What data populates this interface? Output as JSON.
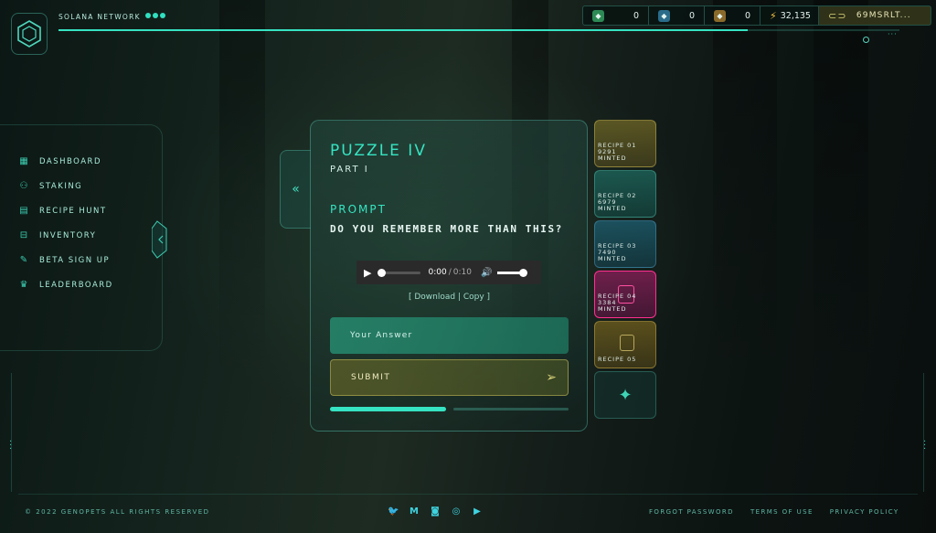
{
  "header": {
    "network_label": "SOLANA NETWORK",
    "stats": [
      {
        "icon": "gene-green-icon",
        "value": "0"
      },
      {
        "icon": "gene-blue-icon",
        "value": "0"
      },
      {
        "icon": "gene-orange-icon",
        "value": "0"
      },
      {
        "icon": "energy-bolt-icon",
        "value": "32,135"
      }
    ],
    "wallet": "69MSRLT...",
    "top_progress": 0.82
  },
  "sidebar": {
    "items": [
      {
        "label": "DASHBOARD",
        "icon": "dashboard-icon"
      },
      {
        "label": "STAKING",
        "icon": "staking-icon"
      },
      {
        "label": "RECIPE HUNT",
        "icon": "recipe-hunt-icon"
      },
      {
        "label": "INVENTORY",
        "icon": "inventory-icon"
      },
      {
        "label": "BETA SIGN UP",
        "icon": "beta-signup-icon"
      },
      {
        "label": "LEADERBOARD",
        "icon": "leaderboard-icon"
      }
    ]
  },
  "puzzle": {
    "title": "PUZZLE IV",
    "part": "PART I",
    "prompt_heading": "PROMPT",
    "prompt_text": "DO YOU REMEMBER MORE THAN THIS?",
    "audio": {
      "current": "0:00",
      "separator": "/",
      "duration": "0:10"
    },
    "download_label": "[ Download | Copy ]",
    "answer_placeholder": "Your Answer",
    "submit_label": "SUBMIT",
    "progress_segments": 2,
    "progress_complete": 1
  },
  "recipes": [
    {
      "line1": "RECIPE 01",
      "line2": "9291",
      "line3": "MINTED"
    },
    {
      "line1": "RECIPE 02",
      "line2": "6979",
      "line3": "MINTED"
    },
    {
      "line1": "RECIPE 03",
      "line2": "7490",
      "line3": "MINTED"
    },
    {
      "line1": "RECIPE 04",
      "line2": "3384",
      "line3": "MINTED"
    },
    {
      "line1": "RECIPE 05",
      "line2": "",
      "line3": ""
    }
  ],
  "footer": {
    "copyright": "© 2022 GENOPETS ALL RIGHTS RESERVED",
    "social": [
      "twitter-icon",
      "medium-icon",
      "discord-icon",
      "instagram-icon",
      "youtube-icon"
    ],
    "links": [
      "FORGOT PASSWORD",
      "TERMS OF USE",
      "PRIVACY POLICY"
    ]
  },
  "colors": {
    "accent": "#35e4c2",
    "active_recipe": "#ff2f8f",
    "wallet_bg": "#6e682a"
  }
}
